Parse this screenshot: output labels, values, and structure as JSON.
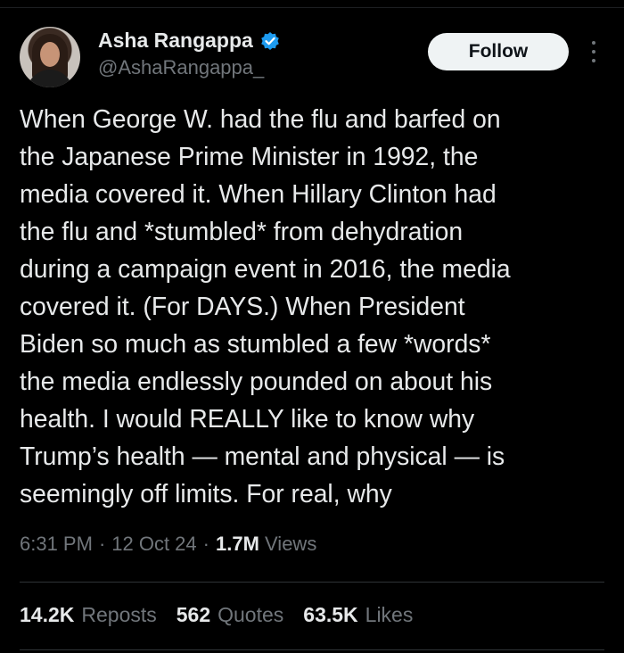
{
  "author": {
    "display_name": "Asha Rangappa",
    "handle": "@AshaRangappa_",
    "verified": true,
    "verified_icon": "verified-badge-icon",
    "verified_color": "#1d9bf0"
  },
  "follow_label": "Follow",
  "more_icon": "vertical-ellipsis-icon",
  "tweet": {
    "text": "When George W. had the flu and barfed on\nthe Japanese Prime Minister in 1992, the\nmedia covered it. When Hillary Clinton had\nthe flu and *stumbled* from dehydration\nduring a campaign event in 2016, the media\ncovered it. (For DAYS.) When President\nBiden so much as stumbled a few *words*\nthe media endlessly pounded on about his\nhealth. I would REALLY like to know why\nTrump’s health — mental and physical — is\nseemingly off limits. For real, why"
  },
  "meta": {
    "time": "6:31 PM",
    "sep1": "·",
    "date": "12 Oct 24",
    "sep2": "·",
    "views_count": "1.7M",
    "views_label": "Views"
  },
  "stats": {
    "reposts_count": "14.2K",
    "reposts_label": "Reposts",
    "quotes_count": "562",
    "quotes_label": "Quotes",
    "likes_count": "63.5K",
    "likes_label": "Likes"
  }
}
